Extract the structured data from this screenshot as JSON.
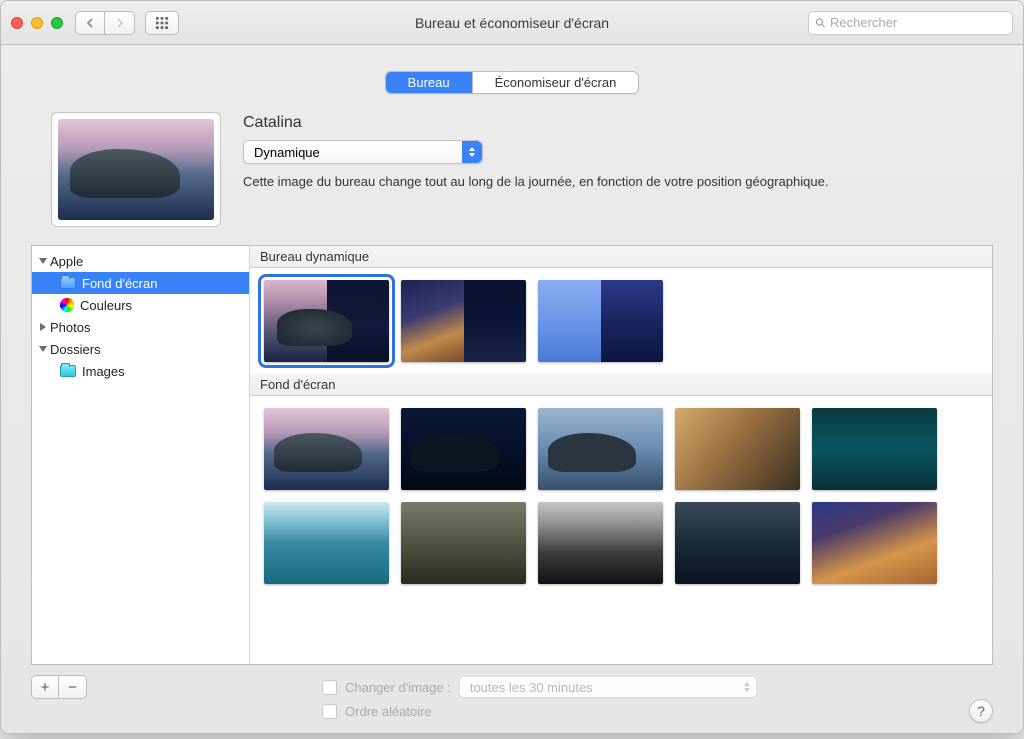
{
  "window": {
    "title": "Bureau et économiseur d'écran"
  },
  "search": {
    "placeholder": "Rechercher"
  },
  "tabs": {
    "desktop": "Bureau",
    "screensaver": "Économiseur d'écran"
  },
  "wallpaper": {
    "name": "Catalina",
    "mode": "Dynamique",
    "description": "Cette image du bureau change tout au long de la journée, en fonction de votre position géographique."
  },
  "sidebar": {
    "apple": "Apple",
    "desktop_pictures": "Fond d'écran",
    "colors": "Couleurs",
    "photos": "Photos",
    "folders": "Dossiers",
    "images": "Images"
  },
  "sections": {
    "dynamic": "Bureau dynamique",
    "desktop": "Fond d'écran"
  },
  "options": {
    "change_label": "Changer d'image :",
    "interval": "toutes les 30 minutes",
    "random_label": "Ordre aléatoire"
  },
  "help": "?"
}
